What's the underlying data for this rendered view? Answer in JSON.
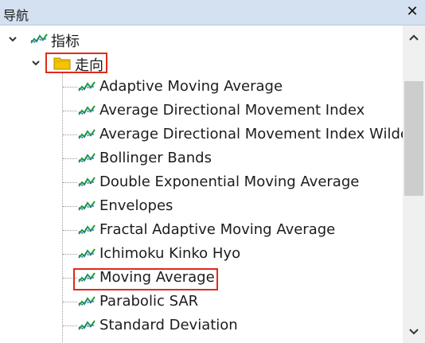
{
  "panel": {
    "title": "导航",
    "close_icon": "close-icon"
  },
  "tree": {
    "root_label": "指标",
    "folder_label": "走向",
    "items": [
      "Adaptive Moving Average",
      "Average Directional Movement Index",
      "Average Directional Movement Index Wilder",
      "Bollinger Bands",
      "Double Exponential Moving Average",
      "Envelopes",
      "Fractal Adaptive Moving Average",
      "Ichimoku Kinko Hyo",
      "Moving Average",
      "Parabolic SAR",
      "Standard Deviation"
    ],
    "highlighted": [
      "走向",
      "Moving Average"
    ]
  },
  "colors": {
    "highlight": "#e02a1c",
    "icon_green": "#1f9e3b",
    "icon_blue": "#1f5fc4",
    "folder": "#f5c400"
  }
}
